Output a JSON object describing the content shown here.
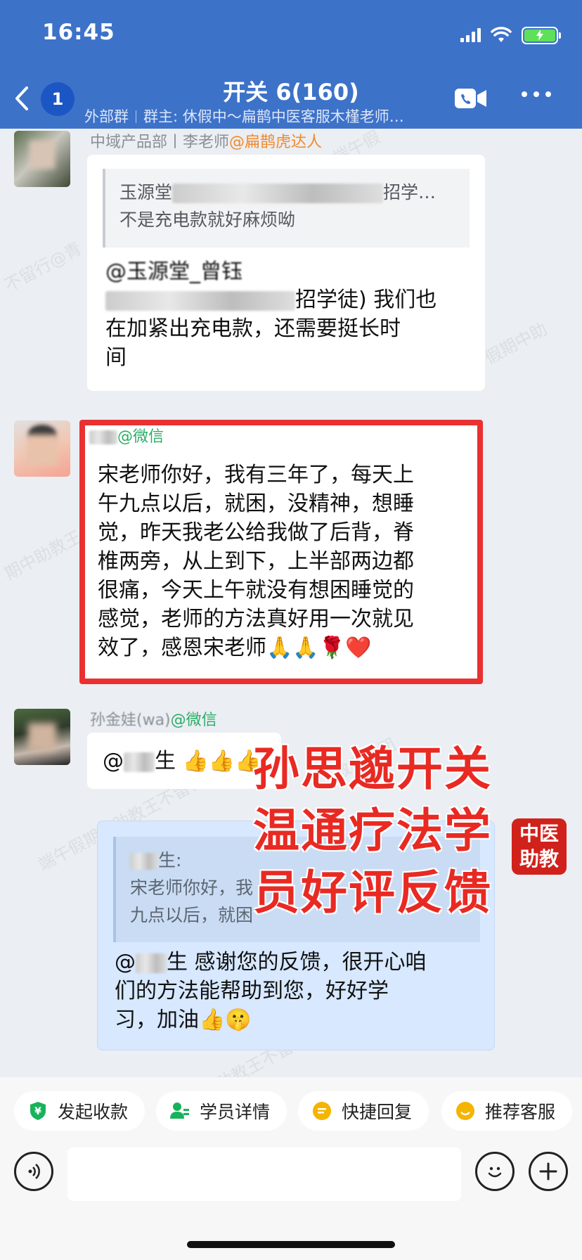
{
  "status_bar": {
    "time": "16:45"
  },
  "header": {
    "back_count": "1",
    "title": "开关 6(160)",
    "subtitle_tag": "外部群",
    "subtitle_owner": "群主: 休假中～扁鹊中医客服木槿老师…"
  },
  "watermarks": [
    "端午假",
    "不留行@青",
    "端午假期中助",
    "期中助教王",
    "端午假期中助教王不留行",
    "教育集团",
    "助教王不留行",
    "端午假期"
  ],
  "messages": [
    {
      "sender": "中域产品部丨李老师",
      "sender_at": "@扁鹊虎达人",
      "quote_line1": "玉源堂",
      "quote_line1_tail": "招学…",
      "quote_line2": "不是充电款就好麻烦呦",
      "text_line1": "@玉源堂_曾钰",
      "text_line2_tail": "招学徒) 我们也",
      "text_line3": "在加紧出充电款，还需要挺长时",
      "text_line4": "间"
    },
    {
      "sender_at": "@微信",
      "text_lines": [
        "宋老师你好，我有三年了，每天上",
        "午九点以后，就困，没精神，想睡",
        "觉，昨天我老公给我做了后背，脊",
        "椎两旁，从上到下，上半部两边都",
        "很痛，今天上午就没有想困睡觉的",
        "感觉，老师的方法真好用一次就见",
        "效了，感恩宋老师🙏🙏🌹❤️"
      ]
    },
    {
      "sender": "孙金娃(wa)",
      "sender_at": "@微信",
      "text_prefix": "@",
      "text_suffix": "生 👍👍👍"
    },
    {
      "quote_name_tail": "生:",
      "quote_line1": "宋老师你好，我",
      "quote_line2": "九点以后，就困",
      "text_line1_prefix": "@",
      "text_line1": "生 感谢您的反馈，很开心咱",
      "text_line2": "们的方法能帮助到您，好好学",
      "text_line3": "习，加油👍🤫"
    }
  ],
  "overlay": {
    "line1": "孙思邈开关",
    "line2": "温通疗法学",
    "line3": "员好评反馈",
    "logo_line1": "中医",
    "logo_line2": "助教"
  },
  "quick_actions": [
    {
      "label": "发起收款",
      "icon": "payment-icon",
      "color": "#18b25b"
    },
    {
      "label": "学员详情",
      "icon": "user-detail-icon",
      "color": "#18b25b"
    },
    {
      "label": "快捷回复",
      "icon": "quick-reply-icon",
      "color": "#f5b400"
    },
    {
      "label": "推荐客服",
      "icon": "service-icon",
      "color": "#f5b400"
    }
  ],
  "colors": {
    "header": "#3d72c9",
    "highlight": "#ea3030",
    "overlay_text": "#e82a23",
    "self_bubble": "#d7e8ff"
  }
}
